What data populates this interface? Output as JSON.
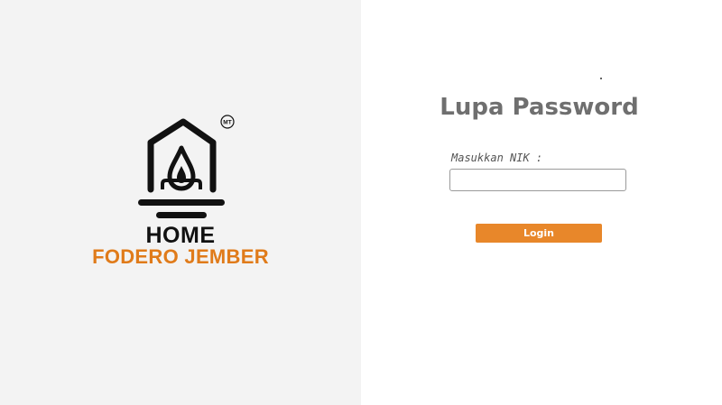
{
  "brand": {
    "logo_icon": "house-flame-logo",
    "badge_text": "MT",
    "line1": "HOME",
    "line2": "FODERO JEMBER",
    "accent_color": "#e07b1a"
  },
  "form": {
    "title": "Lupa Password",
    "nik_label": "Masukkan NIK :",
    "nik_value": "",
    "nik_placeholder": "",
    "submit_label": "Login",
    "submit_color": "#e8872a"
  }
}
